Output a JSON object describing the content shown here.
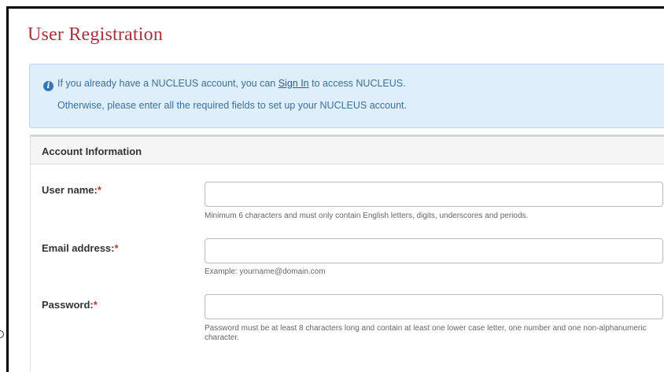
{
  "page": {
    "title": "User Registration"
  },
  "info": {
    "icon": "info-circle-icon",
    "line1_before": "If you already have a NUCLEUS account, you can ",
    "sign_in_link": "Sign In",
    "line1_after": " to access NUCLEUS.",
    "line2": "Otherwise, please enter all the required fields to set up your NUCLEUS account."
  },
  "account": {
    "heading": "Account Information",
    "required_marker": "*",
    "fields": [
      {
        "label": "User name:",
        "value": "",
        "help": "Minimum 6 characters and must only contain English letters, digits, underscores and periods."
      },
      {
        "label": "Email address:",
        "value": "",
        "help": "Example: yourname@domain.com"
      },
      {
        "label": "Password:",
        "value": "",
        "help": "Password must be at least 8 characters long and contain at least one lower case letter, one number and one non-alphanumeric character."
      }
    ]
  },
  "colors": {
    "title": "#a8323e",
    "info_bg": "#dfeefb",
    "info_text": "#3d6f97",
    "required": "#c9302c"
  }
}
